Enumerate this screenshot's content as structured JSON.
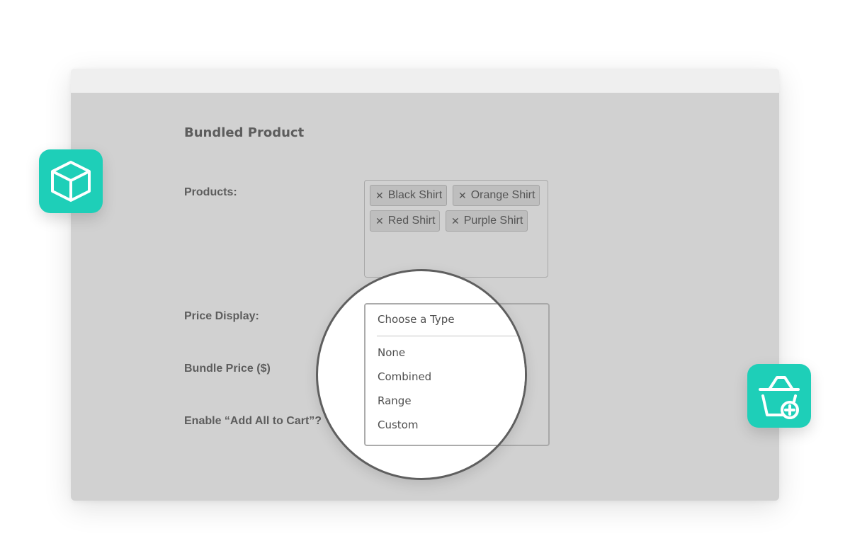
{
  "form": {
    "title": "Bundled Product",
    "labels": {
      "products": "Products:",
      "price_display": "Price Display:",
      "bundle_price": "Bundle Price ($)",
      "add_all": "Enable “Add All to Cart”?"
    },
    "products": {
      "remove_symbol": "✕",
      "tags": [
        "Black Shirt",
        "Orange Shirt",
        "Red Shirt",
        "Purple Shirt"
      ]
    },
    "price_display": {
      "placeholder": "Choose a Type",
      "options": [
        "None",
        "Combined",
        "Range",
        "Custom"
      ]
    }
  },
  "icons": {
    "left_badge": "box-icon",
    "right_badge": "basket-add-icon"
  },
  "colors": {
    "accent": "#1ecfb8",
    "panel": "#d1d1d1",
    "titlebar": "#efefef",
    "label_text": "#5d5d5d"
  }
}
